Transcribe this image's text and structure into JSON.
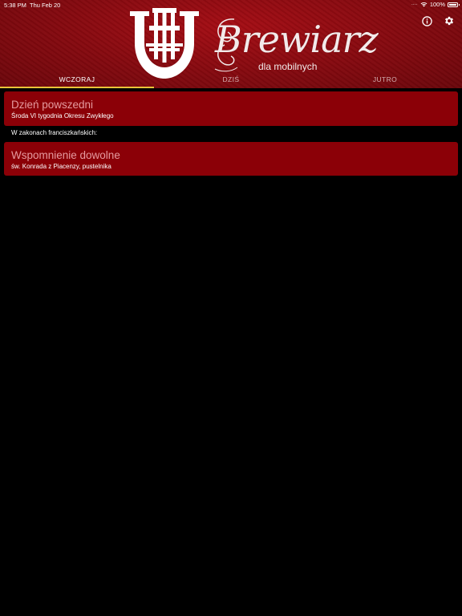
{
  "status_bar": {
    "time": "5:38 PM",
    "date": "Thu Feb 20",
    "battery": "100%"
  },
  "header": {
    "brand_title": "Brewiarz",
    "brand_subtitle": "dla mobilnych",
    "info_icon": "info-icon",
    "settings_icon": "gear-icon",
    "colors": {
      "header_red": "#8a0a10",
      "card_red": "#8b0007",
      "tab_underline": "#e8c33a",
      "card_title": "#e59b9f"
    }
  },
  "tabs": [
    {
      "label": "WCZORAJ",
      "active": true
    },
    {
      "label": "DZIŚ",
      "active": false
    },
    {
      "label": "JUTRO",
      "active": false
    }
  ],
  "entries": [
    {
      "title": "Dzień powszedni",
      "subtitle": "Środa VI tygodnia Okresu Zwykłego"
    },
    {
      "title": "Wspomnienie dowolne",
      "subtitle": "św. Konrada z Piacenzy, pustelnika"
    }
  ],
  "section_label": "W zakonach franciszkańskich:"
}
